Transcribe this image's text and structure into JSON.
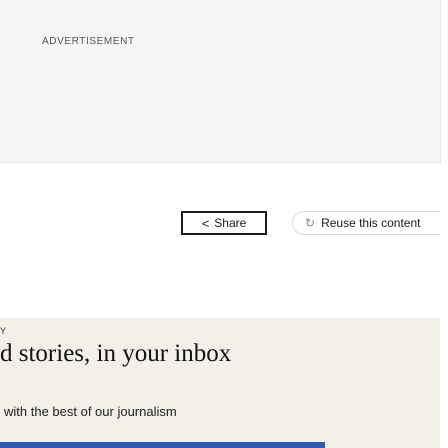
{
  "advertisement": {
    "label": "ADVERTISEMENT"
  },
  "share": {
    "label": "Share",
    "icon": "share-icon"
  },
  "reuse": {
    "label": "Reuse this content",
    "icon": "reuse-icon"
  },
  "newsletter": {
    "kicker": "Y",
    "title": "d stories, in your inbox",
    "subtitle": "with the best of our journalism"
  },
  "colors": {
    "accent": "#2f5bb4",
    "promo_background": "#f3f0ea",
    "ad_background": "#f6f6f6"
  }
}
